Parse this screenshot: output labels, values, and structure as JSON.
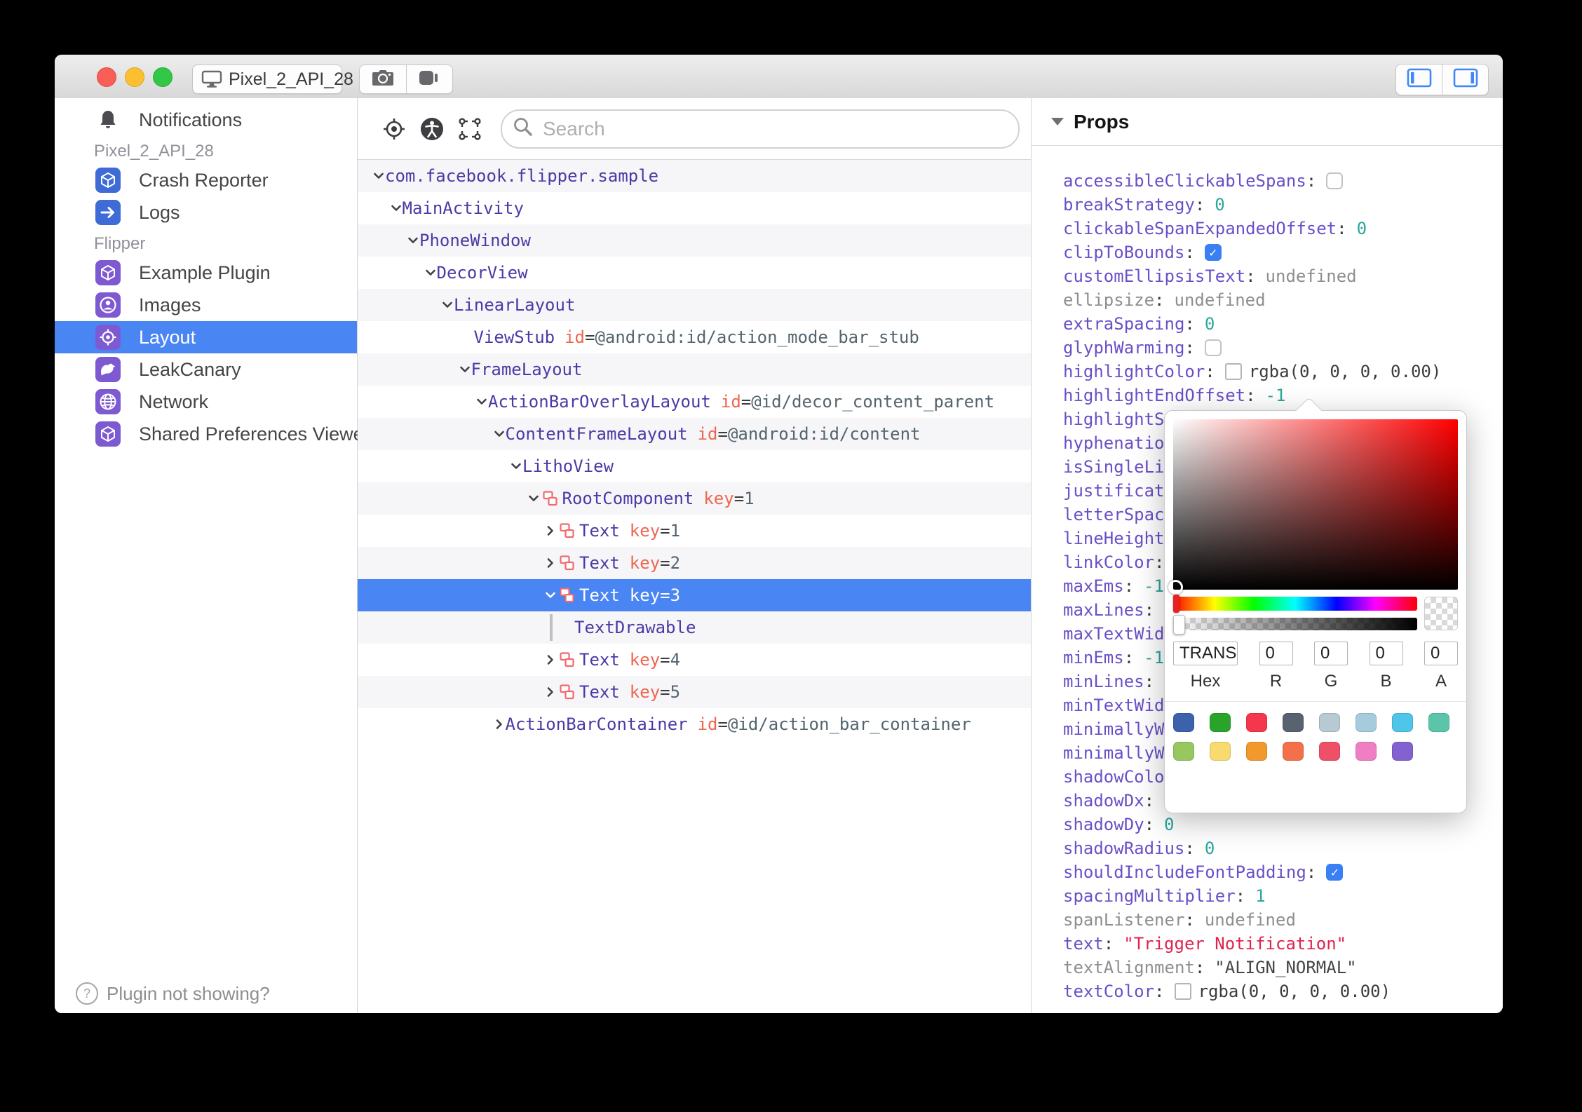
{
  "titlebar": {
    "device_selector": {
      "label": "Pixel_2_API_28"
    },
    "traffic_lights": [
      "close",
      "minimize",
      "zoom"
    ]
  },
  "sidebar": {
    "items": [
      {
        "type": "plain",
        "label": "Notifications",
        "icon": "bell-icon"
      },
      {
        "type": "section",
        "label": "Pixel_2_API_28"
      },
      {
        "type": "plugin",
        "label": "Crash Reporter",
        "icon": "cube-icon",
        "color": "#3e6bd6"
      },
      {
        "type": "plugin",
        "label": "Logs",
        "icon": "arrow-right-icon",
        "color": "#3e6bd6"
      },
      {
        "type": "section",
        "label": "Flipper"
      },
      {
        "type": "plugin",
        "label": "Example Plugin",
        "icon": "cube-icon",
        "color": "#7e5ad2"
      },
      {
        "type": "plugin",
        "label": "Images",
        "icon": "person-circle-icon",
        "color": "#7e5ad2"
      },
      {
        "type": "plugin",
        "label": "Layout",
        "icon": "target-icon",
        "color": "#7e5ad2",
        "selected": true
      },
      {
        "type": "plugin",
        "label": "LeakCanary",
        "icon": "bird-icon",
        "color": "#7e5ad2"
      },
      {
        "type": "plugin",
        "label": "Network",
        "icon": "globe-icon",
        "color": "#7e5ad2"
      },
      {
        "type": "plugin",
        "label": "Shared Preferences Viewer",
        "icon": "cube-icon",
        "color": "#7e5ad2"
      }
    ],
    "footer_label": "Plugin not showing?"
  },
  "inspector": {
    "search_placeholder": "Search",
    "tree": [
      {
        "level": 0,
        "expand": "open",
        "name": "com.facebook.flipper.sample"
      },
      {
        "level": 1,
        "expand": "open",
        "name": "MainActivity"
      },
      {
        "level": 2,
        "expand": "open",
        "name": "PhoneWindow"
      },
      {
        "level": 3,
        "expand": "open",
        "name": "DecorView"
      },
      {
        "level": 4,
        "expand": "open",
        "name": "LinearLayout"
      },
      {
        "level": 5,
        "expand": "leaf",
        "name": "ViewStub",
        "attr_key": "id",
        "attr_value": "@android:id/action_mode_bar_stub"
      },
      {
        "level": 5,
        "expand": "open",
        "name": "FrameLayout"
      },
      {
        "level": 6,
        "expand": "open",
        "name": "ActionBarOverlayLayout",
        "attr_key": "id",
        "attr_value": "@id/decor_content_parent"
      },
      {
        "level": 7,
        "expand": "open",
        "name": "ContentFrameLayout",
        "attr_key": "id",
        "attr_value": "@android:id/content"
      },
      {
        "level": 8,
        "expand": "open",
        "name": "LithoView"
      },
      {
        "level": 9,
        "expand": "open",
        "icon": "litho",
        "name": "RootComponent",
        "attr_key": "key",
        "attr_value": "1"
      },
      {
        "level": 10,
        "expand": "closed",
        "icon": "litho",
        "name": "Text",
        "attr_key": "key",
        "attr_value": "1"
      },
      {
        "level": 10,
        "expand": "closed",
        "icon": "litho",
        "name": "Text",
        "attr_key": "key",
        "attr_value": "2"
      },
      {
        "level": 10,
        "expand": "open",
        "icon": "litho",
        "name": "Text",
        "attr_key": "key",
        "attr_value": "3",
        "selected": true
      },
      {
        "level": 10,
        "expand": "line",
        "name": "TextDrawable"
      },
      {
        "level": 10,
        "expand": "closed",
        "icon": "litho",
        "name": "Text",
        "attr_key": "key",
        "attr_value": "4"
      },
      {
        "level": 10,
        "expand": "closed",
        "icon": "litho",
        "name": "Text",
        "attr_key": "key",
        "attr_value": "5"
      },
      {
        "level": 7,
        "expand": "closed",
        "name": "ActionBarContainer",
        "attr_key": "id",
        "attr_value": "@id/action_bar_container"
      }
    ]
  },
  "props_panel": {
    "title": "Props",
    "rows": [
      {
        "key": "accessibleClickableSpans",
        "type": "checkbox",
        "checked": false
      },
      {
        "key": "breakStrategy",
        "type": "number",
        "value": "0"
      },
      {
        "key": "clickableSpanExpandedOffset",
        "type": "number",
        "value": "0"
      },
      {
        "key": "clipToBounds",
        "type": "checkbox",
        "checked": true
      },
      {
        "key": "customEllipsisText",
        "type": "muted",
        "value": "undefined"
      },
      {
        "key": "ellipsize",
        "type": "muted",
        "value": "undefined",
        "key_muted": true
      },
      {
        "key": "extraSpacing",
        "type": "number",
        "value": "0"
      },
      {
        "key": "glyphWarming",
        "type": "checkbox",
        "checked": false
      },
      {
        "key": "highlightColor",
        "type": "color",
        "value": "rgba(0, 0, 0, 0.00)"
      },
      {
        "key": "highlightEndOffset",
        "type": "number",
        "value": "-1"
      },
      {
        "key": "highlightS",
        "type": "none"
      },
      {
        "key": "hyphenatio",
        "type": "none"
      },
      {
        "key": "isSingleLi",
        "type": "none"
      },
      {
        "key": "justificat",
        "type": "none"
      },
      {
        "key": "letterSpac",
        "type": "none"
      },
      {
        "key": "lineHeight",
        "type": "none"
      },
      {
        "key": "linkColor",
        "type": "colon"
      },
      {
        "key": "maxEms",
        "type": "number",
        "value": "-1"
      },
      {
        "key": "maxLines",
        "type": "colon"
      },
      {
        "key": "maxTextWid",
        "type": "none"
      },
      {
        "key": "minEms",
        "type": "number",
        "value": "-1"
      },
      {
        "key": "minLines",
        "type": "colon"
      },
      {
        "key": "minTextWid",
        "type": "none"
      },
      {
        "key": "minimallyW",
        "type": "none"
      },
      {
        "key": "minimallyW",
        "type": "none"
      },
      {
        "key": "shadowColo",
        "type": "none"
      },
      {
        "key": "shadowDx",
        "type": "colon"
      },
      {
        "key": "shadowDy",
        "type": "number",
        "value": "0"
      },
      {
        "key": "shadowRadius",
        "type": "number",
        "value": "0"
      },
      {
        "key": "shouldIncludeFontPadding",
        "type": "checkbox",
        "checked": true
      },
      {
        "key": "spacingMultiplier",
        "type": "number",
        "value": "1"
      },
      {
        "key": "spanListener",
        "type": "muted",
        "value": "undefined",
        "key_muted": true
      },
      {
        "key": "text",
        "type": "string",
        "value": "\"Trigger Notification\""
      },
      {
        "key": "textAlignment",
        "type": "enum",
        "value": "\"ALIGN_NORMAL\"",
        "key_muted": true
      },
      {
        "key": "textColor",
        "type": "color",
        "value": "rgba(0, 0, 0, 0.00)"
      }
    ]
  },
  "color_picker": {
    "hex_value": "TRANS",
    "r_value": "0",
    "g_value": "0",
    "b_value": "0",
    "a_value": "0",
    "labels": {
      "hex": "Hex",
      "r": "R",
      "g": "G",
      "b": "B",
      "a": "A"
    },
    "presets_row1": [
      "#3c62ae",
      "#2aa32a",
      "#f5374d",
      "#586270",
      "#b7c9d3",
      "#a6cbdd",
      "#4ec5e9",
      "#5bc5a9"
    ],
    "presets_row2": [
      "#97c75f",
      "#f8da6e",
      "#f2992e",
      "#f4704a",
      "#ee5068",
      "#ee7fc3",
      "#8261d1"
    ]
  },
  "colors": {
    "selection_blue": "#4a85f4",
    "plugin_blue": "#3e6bd6",
    "plugin_purple": "#7e5ad2",
    "tree_name_purple": "#4b3aa5",
    "attr_orange": "#ee6550",
    "attr_value_slate": "#54656e",
    "prop_key_purple": "#6a4fc8",
    "prop_number_teal": "#2aa79b",
    "prop_string_red": "#e0234e",
    "checkbox_blue": "#3b7ff5",
    "litho_pink": "#f2696f"
  }
}
